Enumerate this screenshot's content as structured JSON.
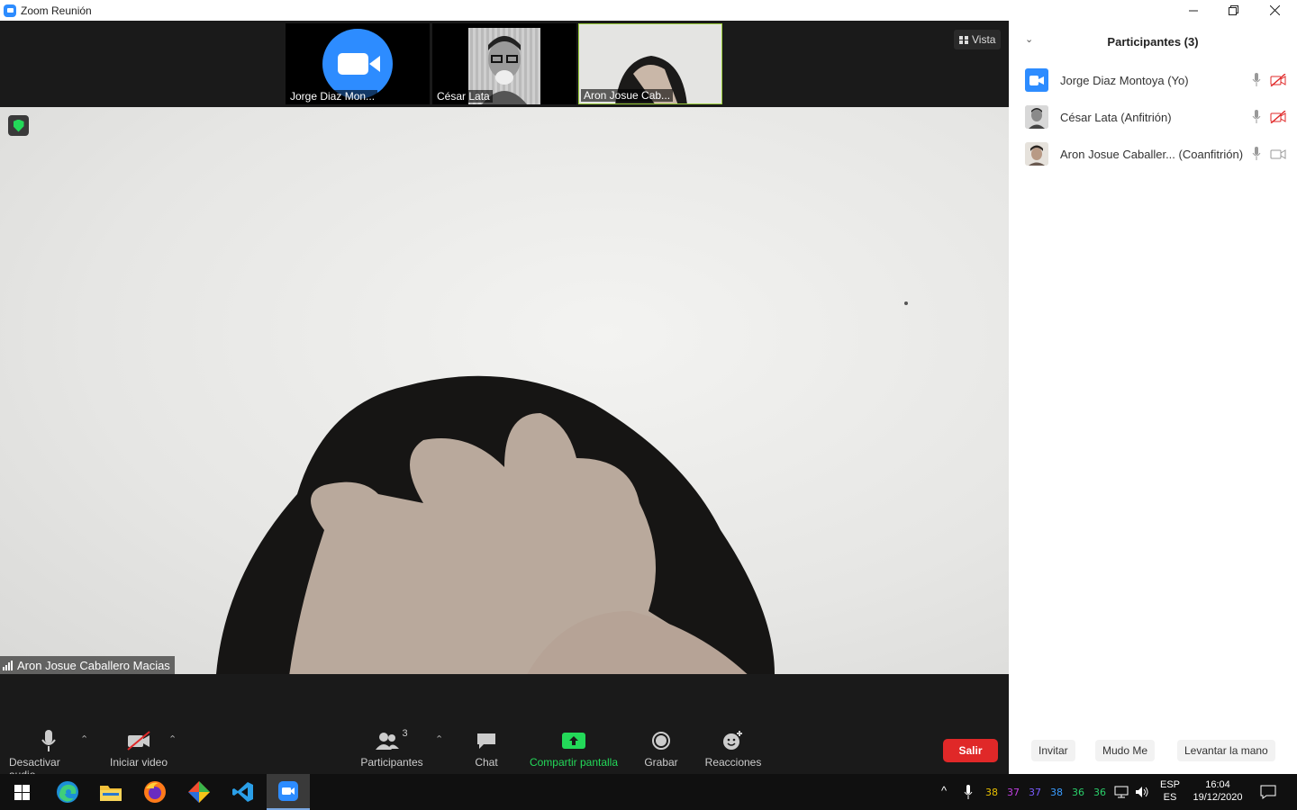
{
  "window": {
    "title": "Zoom Reunión"
  },
  "thumbnails": [
    {
      "name": "Jorge Diaz Mon...",
      "kind": "zoom-logo",
      "active": false
    },
    {
      "name": "César Lata",
      "kind": "photo",
      "active": false
    },
    {
      "name": "Aron Josue Cab...",
      "kind": "photo",
      "active": true
    }
  ],
  "view_button": {
    "label": "Vista",
    "icon": "grid-icon"
  },
  "main_video": {
    "speaker_name": "Aron Josue Caballero Macias",
    "icons": [
      "security-shield-icon",
      "signal-bars-icon"
    ]
  },
  "toolbar": {
    "mute_label": "Desactivar audio",
    "video_label": "Iniciar video",
    "participants_label": "Participantes",
    "participants_count": "3",
    "chat_label": "Chat",
    "share_label": "Compartir pantalla",
    "record_label": "Grabar",
    "reactions_label": "Reacciones",
    "leave_label": "Salir"
  },
  "panel": {
    "title": "Participantes (3)",
    "participants": [
      {
        "name": "Jorge Diaz Montoya (Yo)",
        "mic": "mic-icon",
        "video": "video-off-icon"
      },
      {
        "name": "César Lata (Anfitrión)",
        "mic": "mic-icon",
        "video": "video-off-icon"
      },
      {
        "name": "Aron Josue Caballer... (Coanfitrión)",
        "mic": "mic-icon",
        "video": "video-on-icon"
      }
    ],
    "buttons": {
      "invite": "Invitar",
      "mute_me": "Mudo Me",
      "raise_hand": "Levantar la mano"
    }
  },
  "taskbar": {
    "apps": [
      "windows-start-icon",
      "edge-icon",
      "file-explorer-icon",
      "firefox-icon",
      "git-kraken-icon",
      "vscode-icon",
      "zoom-icon"
    ],
    "tray_numbers": [
      {
        "value": "38",
        "color": "#e8c000"
      },
      {
        "value": "37",
        "color": "#c040e0"
      },
      {
        "value": "37",
        "color": "#7a5cff"
      },
      {
        "value": "38",
        "color": "#3a9cff"
      },
      {
        "value": "36",
        "color": "#2ad06a"
      },
      {
        "value": "36",
        "color": "#2ad06a"
      }
    ],
    "language": "ESP",
    "layout": "ES",
    "time": "16:04",
    "date": "19/12/2020"
  },
  "colors": {
    "zoom_blue": "#2d8cff",
    "leave_red": "#e02828",
    "share_green": "#23d959",
    "active_border": "#9bcf3a"
  }
}
